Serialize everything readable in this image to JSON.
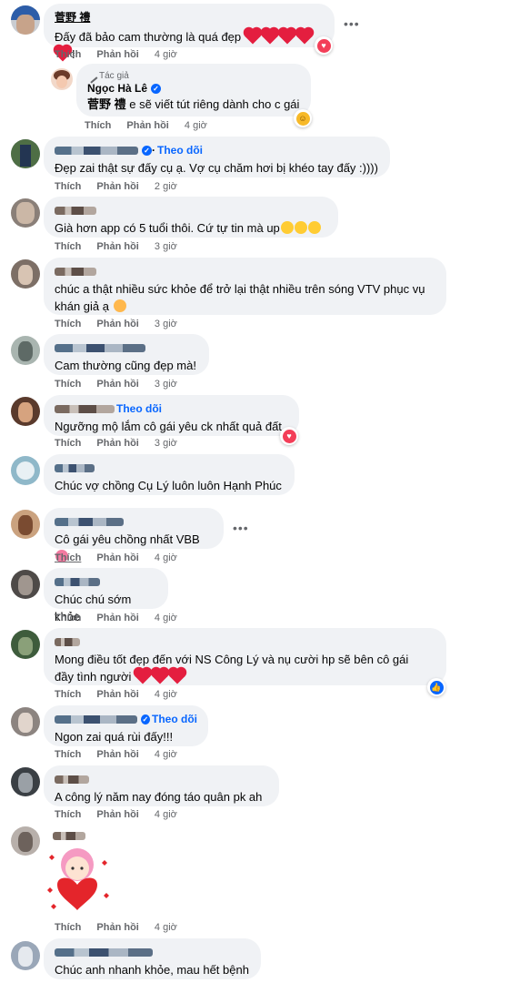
{
  "actions": {
    "like": "Thích",
    "reply": "Phản hồi",
    "follow": "Theo dõi"
  },
  "comments": [
    {
      "name": "菅野 禮",
      "text": "Đấy đã bảo cam thường là quá đẹp",
      "text_suffix": "!",
      "time": "4 giờ",
      "reaction": "love"
    },
    {
      "author_tag": "Tác giả",
      "name": "Ngọc Hà Lê",
      "name_prefix": "菅野 禮",
      "text": "e sẽ viết tút riêng dành cho c gái",
      "time": "4 giờ",
      "reaction": "haha"
    },
    {
      "text": "Đẹp zai thật sự đấy cụ ạ. Vợ cụ chăm hơi bị khéo tay đấy :))))",
      "time": "2 giờ"
    },
    {
      "text": "Già hơn app có 5 tuổi thôi. Cứ tự tin mà up",
      "time": "3 giờ"
    },
    {
      "text_line1": "chúc a thật nhiều sức khỏe để trở lại thật nhiều trên sóng VTV phục vụ",
      "text_line2": "khán giả ạ",
      "time": "3 giờ"
    },
    {
      "text": "Cam thường cũng đẹp mà!",
      "time": "3 giờ"
    },
    {
      "text": "Ngưỡng mộ lắm cô gái yêu ck nhất quả đất",
      "time": "3 giờ",
      "reaction": "love"
    },
    {
      "text": "Chúc vợ chồng Cụ Lý luôn luôn Hạnh Phúc",
      "time": ""
    },
    {
      "text": "Cô gái yêu chồng nhất VBB",
      "time": "4 giờ"
    },
    {
      "text": "Chúc chú sớm khỏe",
      "time": "4 giờ"
    },
    {
      "text_line1": "Mong điều tốt đẹp đến với NS Công Lý và nụ cười hp sẽ bên cô gái",
      "text_line2": "đầy tình người",
      "time": "4 giờ",
      "reaction": "like"
    },
    {
      "text": "Ngon zai quá rùi đấy!!!",
      "time": "4 giờ"
    },
    {
      "text": "A công lý năm nay đóng táo quân pk ah",
      "time": "4 giờ"
    },
    {
      "text": "",
      "time": "4 giờ"
    },
    {
      "text": "Chúc anh nhanh khỏe, mau hết bệnh",
      "time": ""
    }
  ],
  "colors": {
    "accent": "#0866ff",
    "love": "#f33e58",
    "bubble": "#f0f2f5",
    "meta": "#65676b"
  },
  "icons": {
    "verified": "verified-badge-icon",
    "more": "more-options-icon",
    "author": "pen-icon"
  }
}
